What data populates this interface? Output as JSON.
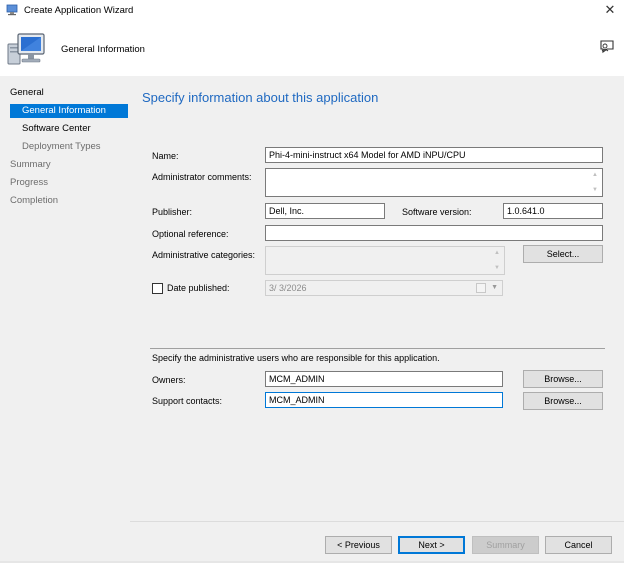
{
  "window": {
    "title": "Create Application Wizard"
  },
  "header": {
    "title": "General Information"
  },
  "sidebar": {
    "items": [
      {
        "label": "General"
      },
      {
        "label": "General Information"
      },
      {
        "label": "Software Center"
      },
      {
        "label": "Deployment Types"
      },
      {
        "label": "Summary"
      },
      {
        "label": "Progress"
      },
      {
        "label": "Completion"
      }
    ]
  },
  "main": {
    "title": "Specify information about this application",
    "name": {
      "label": "Name:",
      "value": "Phi-4-mini-instruct x64 Model for AMD iNPU/CPU"
    },
    "admin_comments": {
      "label": "Administrator comments:"
    },
    "publisher": {
      "label": "Publisher:",
      "value": "Dell, Inc."
    },
    "software_version": {
      "label": "Software version:",
      "value": "1.0.641.0"
    },
    "optional_reference": {
      "label": "Optional reference:"
    },
    "admin_categories": {
      "label": "Administrative categories:",
      "button": "Select..."
    },
    "date_published": {
      "label": "Date published:",
      "value": "3/  3/2026",
      "checked": false
    },
    "admin_users_text": "Specify the administrative users who are responsible for this application.",
    "owners": {
      "label": "Owners:",
      "value": "MCM_ADMIN",
      "button": "Browse..."
    },
    "support_contacts": {
      "label": "Support contacts:",
      "value": "MCM_ADMIN",
      "button": "Browse..."
    }
  },
  "footer": {
    "previous": "< Previous",
    "next": "Next >",
    "summary": "Summary",
    "cancel": "Cancel"
  },
  "colors": {
    "accent": "#0078d7",
    "title_blue": "#1f69c1",
    "panel": "#f0f0f0"
  }
}
